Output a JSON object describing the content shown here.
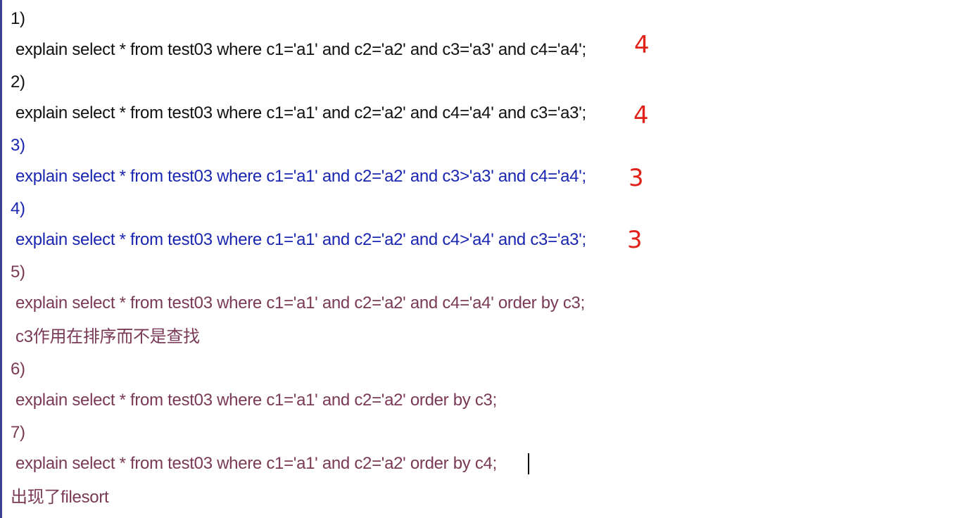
{
  "items": [
    {
      "num": "1)",
      "sql": "explain select * from test03 where c1='a1' and c2='a2' and c3='a3' and c4='a4';",
      "annotation": "4"
    },
    {
      "num": "2)",
      "sql": "explain select * from test03 where c1='a1' and c2='a2' and c4='a4' and c3='a3';",
      "annotation": "4"
    },
    {
      "num": "3)",
      "sql": "explain select * from test03 where c1='a1' and c2='a2' and c3>'a3' and c4='a4';",
      "annotation": "3"
    },
    {
      "num": "4)",
      "sql": "explain select * from test03 where c1='a1' and c2='a2' and c4>'a4' and c3='a3';",
      "annotation": "3"
    },
    {
      "num": "5)",
      "sql": "explain select * from test03 where c1='a1' and c2='a2' and c4='a4' order by c3;",
      "note": "c3作用在排序而不是查找"
    },
    {
      "num": "6)",
      "sql": "explain select * from test03 where c1='a1' and c2='a2' order by c3;"
    },
    {
      "num": "7)",
      "sql": "explain select * from test03 where c1='a1' and c2='a2' order by c4;",
      "note": "出现了filesort"
    }
  ],
  "colors": {
    "black": "#111111",
    "blue": "#1a26b0",
    "plum": "#7a3a55",
    "annotation": "#e0221a"
  }
}
